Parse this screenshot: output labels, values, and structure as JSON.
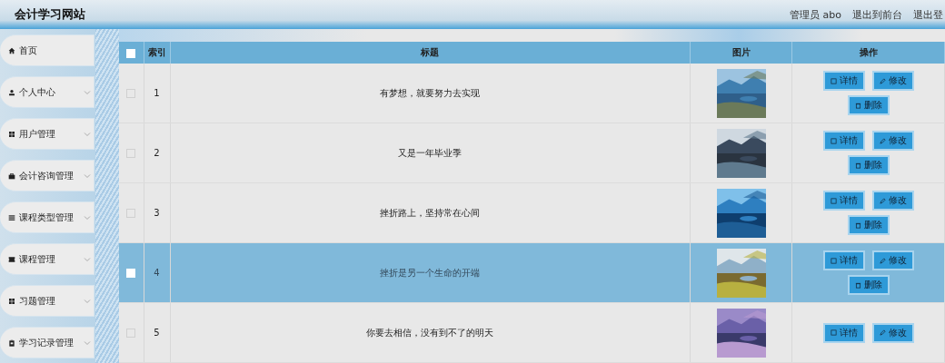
{
  "header": {
    "title": "会计学习网站",
    "links": [
      "管理员 abo",
      "退出到前台",
      "退出登"
    ]
  },
  "sidebar": {
    "items": [
      {
        "label": "首页",
        "expandable": false
      },
      {
        "label": "个人中心",
        "expandable": true
      },
      {
        "label": "用户管理",
        "expandable": true
      },
      {
        "label": "会计咨询管理",
        "expandable": true
      },
      {
        "label": "课程类型管理",
        "expandable": true
      },
      {
        "label": "课程管理",
        "expandable": true
      },
      {
        "label": "习题管理",
        "expandable": true
      },
      {
        "label": "学习记录管理",
        "expandable": true
      }
    ]
  },
  "table": {
    "select_all": {
      "checked": false
    },
    "columns": [
      "索引",
      "标题",
      "图片",
      "操作"
    ],
    "rows": [
      {
        "index": "1",
        "title": "有梦想，就要努力去实现",
        "picture": {
          "kind": "picture"
        },
        "selected": false,
        "checked": false,
        "actions": [
          "详情",
          "修改",
          "删除"
        ]
      },
      {
        "index": "2",
        "title": "又是一年毕业季",
        "picture": {
          "kind": "picture"
        },
        "selected": false,
        "checked": false,
        "actions": [
          "详情",
          "修改",
          "删除"
        ]
      },
      {
        "index": "3",
        "title": "挫折路上，坚持常在心间",
        "picture": {
          "kind": "picture"
        },
        "selected": false,
        "checked": false,
        "actions": [
          "详情",
          "修改",
          "删除"
        ]
      },
      {
        "index": "4",
        "title": "挫折是另一个生命的开端",
        "picture": {
          "kind": "picture"
        },
        "selected": true,
        "checked": false,
        "actions": [
          "详情",
          "修改",
          "删除"
        ]
      },
      {
        "index": "5",
        "title": "你要去相信，没有到不了的明天",
        "picture": {
          "kind": "picture"
        },
        "selected": false,
        "checked": false,
        "actions": [
          "详情",
          "修改"
        ]
      }
    ]
  }
}
